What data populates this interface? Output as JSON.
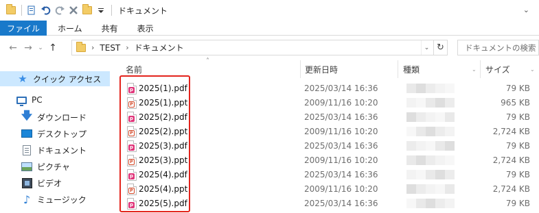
{
  "window": {
    "title": "ドキュメント",
    "qat_icons": [
      "folder-icon",
      "properties-icon",
      "undo-icon",
      "redo-icon",
      "delete-icon",
      "new-folder-icon",
      "customize-caret-icon"
    ]
  },
  "ribbon": {
    "tabs": [
      {
        "label": "ファイル",
        "active": true
      },
      {
        "label": "ホーム"
      },
      {
        "label": "共有"
      },
      {
        "label": "表示"
      }
    ]
  },
  "address": {
    "segments": [
      "TEST",
      "ドキュメント"
    ],
    "search_placeholder": "ドキュメントの検索"
  },
  "navigation": {
    "items": [
      {
        "label": "クイック アクセス",
        "icon": "star-icon",
        "selected": true
      },
      {
        "label": "PC",
        "icon": "pc-icon"
      },
      {
        "label": "ダウンロード",
        "icon": "download-icon"
      },
      {
        "label": "デスクトップ",
        "icon": "desktop-icon"
      },
      {
        "label": "ドキュメント",
        "icon": "document-icon"
      },
      {
        "label": "ピクチャ",
        "icon": "pictures-icon"
      },
      {
        "label": "ビデオ",
        "icon": "videos-icon"
      },
      {
        "label": "ミュージック",
        "icon": "music-icon"
      }
    ]
  },
  "columns": {
    "name": "名前",
    "modified": "更新日時",
    "type": "種類",
    "size": "サイズ"
  },
  "files": [
    {
      "name": "2025(1).pdf",
      "modified": "2025/03/14 16:36",
      "size": "79 KB",
      "kind": "pdf"
    },
    {
      "name": "2025(1).ppt",
      "modified": "2009/11/16 10:20",
      "size": "965 KB",
      "kind": "ppt"
    },
    {
      "name": "2025(2).pdf",
      "modified": "2025/03/14 16:36",
      "size": "79 KB",
      "kind": "pdf"
    },
    {
      "name": "2025(2).ppt",
      "modified": "2009/11/16 10:20",
      "size": "2,724 KB",
      "kind": "ppt"
    },
    {
      "name": "2025(3).pdf",
      "modified": "2025/03/14 16:36",
      "size": "79 KB",
      "kind": "pdf"
    },
    {
      "name": "2025(3).ppt",
      "modified": "2009/11/16 10:20",
      "size": "2,724 KB",
      "kind": "ppt"
    },
    {
      "name": "2025(4).pdf",
      "modified": "2025/03/14 16:36",
      "size": "79 KB",
      "kind": "pdf"
    },
    {
      "name": "2025(4).ppt",
      "modified": "2009/11/16 10:20",
      "size": "2,724 KB",
      "kind": "ppt"
    },
    {
      "name": "2025(5).pdf",
      "modified": "2025/03/14 16:36",
      "size": "79 KB",
      "kind": "pdf"
    }
  ],
  "colors": {
    "file_tab": "#1979ca",
    "selected_nav": "#cce8ff",
    "highlight_box": "#e3231c",
    "pdf_badge": "#e0357a"
  }
}
